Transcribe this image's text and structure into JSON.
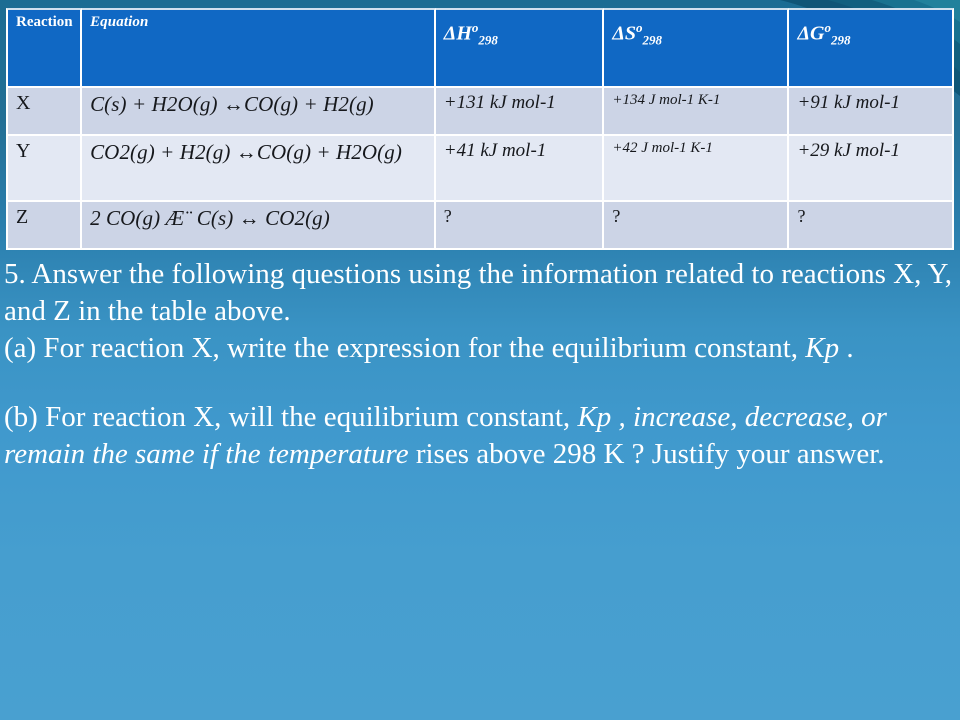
{
  "slide": {
    "background_top_color": "#1b6c93",
    "background_bottom_color": "#49a0d0",
    "header_fill": "#1068c4",
    "row_shade_dark": "#ccd4e6",
    "row_shade_light": "#e3e8f3",
    "grid_line_color": "#ffffff"
  },
  "table": {
    "headers": {
      "reaction": "Reaction",
      "equation": "Equation",
      "dh": {
        "delta": "Δ",
        "symbol": "H",
        "sup": "o",
        "sub": "298"
      },
      "ds": {
        "delta": "Δ",
        "symbol": "S",
        "sup": "o",
        "sub": "298"
      },
      "dg": {
        "delta": "Δ",
        "symbol": "G",
        "sup": "o",
        "sub": "298"
      }
    },
    "rows": [
      {
        "reaction": "X",
        "equation": "C(s) + H2O(g) ↔CO(g) + H2(g)",
        "dh": "+131 kJ mol-1",
        "ds": "+134 J mol-1 K-1",
        "dg": "+91 kJ mol-1"
      },
      {
        "reaction": "Y",
        "equation": "CO2(g) + H2(g) ↔CO(g) + H2O(g)",
        "dh": "+41 kJ mol-1",
        "ds": "+42 J mol-1 K-1",
        "dg": "+29 kJ mol-1"
      },
      {
        "reaction": "Z",
        "equation": "2 CO(g) Æ¨ C(s) ↔ CO2(g)",
        "dh": "?",
        "ds": "?",
        "dg": "?"
      }
    ]
  },
  "question": {
    "stem": "5. Answer the following questions using the information related to reactions X, Y, and Z in the table above.",
    "part_a": {
      "lead": "(a) For reaction X, write the expression for the equilibrium constant, ",
      "italic_1": "Kp",
      "tail": " ."
    },
    "part_b": {
      "lead": "(b) For reaction X, will the equilibrium constant, ",
      "italic_1": "Kp , increase, decrease, or remain the same if the temperature",
      "tail": " rises above 298 K ? Justify your answer."
    }
  }
}
